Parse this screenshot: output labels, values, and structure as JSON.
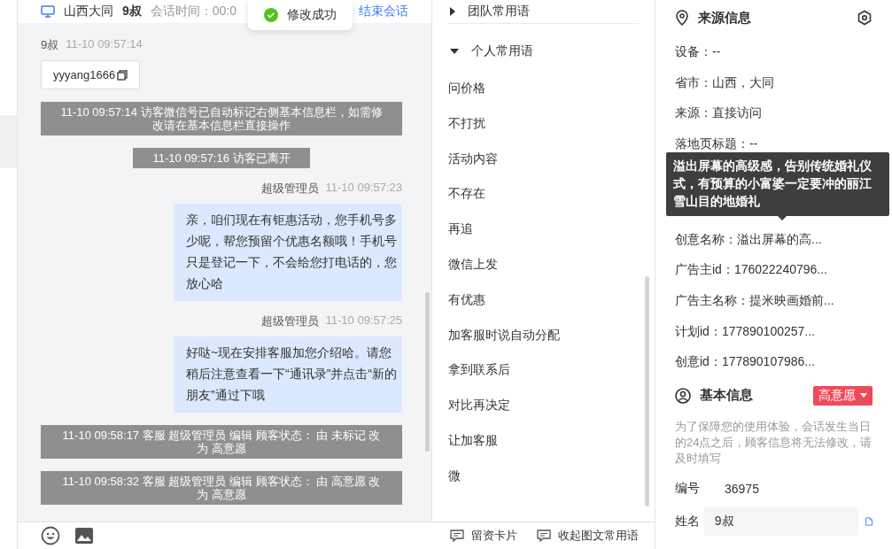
{
  "chat_header": {
    "location": "山西大同",
    "visitor": "9叔",
    "session_time": "会话时间：00:0",
    "end_button": "结束会话"
  },
  "toast": {
    "text": "修改成功"
  },
  "messages": [
    {
      "kind": "visitor",
      "name": "9叔",
      "time": "11-10 09:57:14",
      "card": "yyyang1666"
    },
    {
      "kind": "system",
      "text": "11-10 09:57:14 访客微信号已自动标记右侧基本信息栏，如需修改请在基本信息栏直接操作"
    },
    {
      "kind": "system",
      "text": "11-10 09:57:16 访客已离开"
    },
    {
      "kind": "agent",
      "name": "超级管理员",
      "time": "11-10 09:57:23",
      "text": "亲，咱们现在有钜惠活动，您手机号多少呢，帮您预留个优惠名额哦！手机号只是登记一下，不会给您打电话的，您放心哈"
    },
    {
      "kind": "agent",
      "name": "超级管理员",
      "time": "11-10 09:57:25",
      "text": "好哒~现在安排客服加您介绍哈。请您稍后注意查看一下“通讯录”并点击“新的朋友”通过下哦"
    },
    {
      "kind": "system",
      "text": "11-10 09:58:17 客服 超级管理员 编辑 顾客状态： 由 未标记 改为 高意愿"
    },
    {
      "kind": "system",
      "text": "11-10 09:58:32 客服 超级管理员 编辑 顾客状态： 由 高意愿 改为 高意愿"
    }
  ],
  "phrase_groups": [
    {
      "title": "团队常用语",
      "expanded": false
    },
    {
      "title": "个人常用语",
      "expanded": true,
      "items": [
        "问价格",
        "不打扰",
        "活动内容",
        "不存在",
        "再追",
        "微信上发",
        "有优惠",
        "加客服时说自动分配",
        "拿到联系后",
        "对比再决定",
        "让加客服",
        "微"
      ]
    }
  ],
  "bottom_actions": [
    "留资卡片",
    "收起图文常用语"
  ],
  "source_info": {
    "title": "来源信息",
    "rows": [
      "设备：--",
      "省市：山西，大同",
      "来源：直接访问",
      "落地页标题：--",
      "创意名称：溢出屏幕的高...",
      "广告主id：176022240796...",
      "广告主名称：提米映画婚前...",
      "计划id：177890100257...",
      "创意id：177890107986..."
    ]
  },
  "tooltip": {
    "text": "溢出屏幕的高级感，告别传统婚礼仪式，有预算的小富婆一定要冲的丽江雪山目的地婚礼"
  },
  "basic_info": {
    "title": "基本信息",
    "tag": "高意愿",
    "note": "为了保障您的使用体验，会话发生当日的24点之后，顾客信息将无法修改，请及时填写",
    "fields": [
      {
        "label": "编号",
        "value": "36975",
        "kind": "text"
      },
      {
        "label": "姓名",
        "value": "9叔",
        "kind": "input"
      }
    ]
  }
}
